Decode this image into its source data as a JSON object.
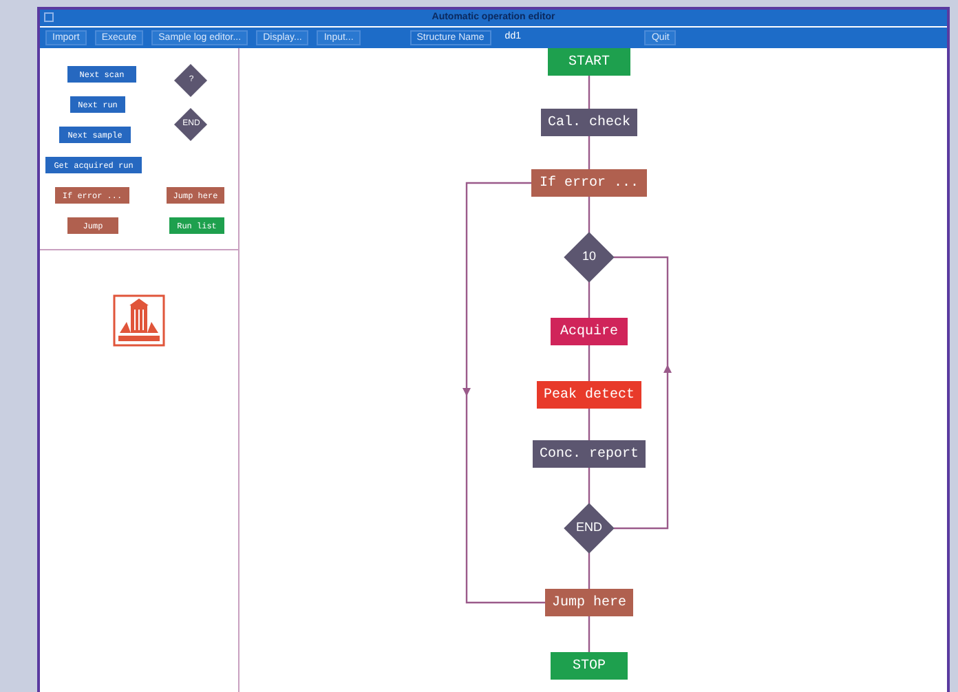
{
  "window": {
    "title": "Automatic operation editor"
  },
  "menu": [
    {
      "label": "Import",
      "kind": "item"
    },
    {
      "label": "Execute",
      "kind": "item"
    },
    {
      "label": "Sample log editor...",
      "kind": "item"
    },
    {
      "label": "Display...",
      "kind": "item"
    },
    {
      "label": "Input...",
      "kind": "item"
    },
    {
      "label": "Structure Name",
      "kind": "label"
    },
    {
      "label": "dd1",
      "kind": "value"
    },
    {
      "label": "Quit",
      "kind": "item"
    }
  ],
  "palette": [
    {
      "label": "Next scan",
      "kind": "box",
      "color": "#2668c0"
    },
    {
      "label": "?",
      "kind": "diamond",
      "color": "#5c5670"
    },
    {
      "label": "Next run",
      "kind": "box",
      "color": "#2668c0"
    },
    {
      "label": "END",
      "kind": "diamond",
      "color": "#5c5670"
    },
    {
      "label": "Next sample",
      "kind": "box",
      "color": "#2668c0"
    },
    {
      "label": "Get acquired run",
      "kind": "box",
      "color": "#2668c0"
    },
    {
      "label": "If error ...",
      "kind": "box",
      "color": "#b0604f"
    },
    {
      "label": "Jump here",
      "kind": "box",
      "color": "#b0604f"
    },
    {
      "label": "Jump",
      "kind": "box",
      "color": "#b0604f"
    },
    {
      "label": "Run list",
      "kind": "box",
      "color": "#1ea04e"
    }
  ],
  "flowchart": [
    {
      "label": "START",
      "kind": "box",
      "color": "#1ea04e"
    },
    {
      "label": "Cal. check",
      "kind": "box",
      "color": "#5c5670"
    },
    {
      "label": "If error ...",
      "kind": "box",
      "color": "#b0604f"
    },
    {
      "label": "10",
      "kind": "diamond",
      "color": "#5c5670"
    },
    {
      "label": "Acquire",
      "kind": "box",
      "color": "#d0245a"
    },
    {
      "label": "Peak detect",
      "kind": "box",
      "color": "#e83a2a"
    },
    {
      "label": "Conc. report",
      "kind": "box",
      "color": "#5c5670"
    },
    {
      "label": "END",
      "kind": "diamond",
      "color": "#5c5670"
    },
    {
      "label": "Jump here",
      "kind": "box",
      "color": "#b0604f"
    },
    {
      "label": "STOP",
      "kind": "box",
      "color": "#1ea04e"
    }
  ]
}
